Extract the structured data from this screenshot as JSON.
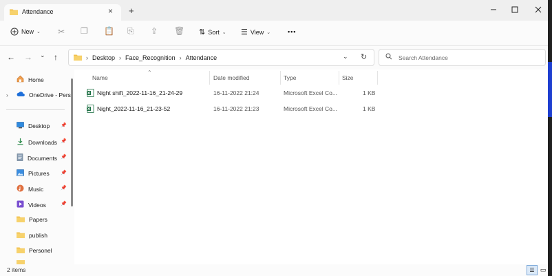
{
  "window": {
    "tab_title": "Attendance",
    "new_tab": "+",
    "minimize": "—",
    "maximize": "☐",
    "close": "✕"
  },
  "toolbar": {
    "new_label": "New",
    "sort_label": "Sort",
    "view_label": "View",
    "more_label": "•••"
  },
  "address": {
    "crumbs": [
      "Desktop",
      "Face_Recognition",
      "Attendance"
    ],
    "search_placeholder": "Search Attendance"
  },
  "sidebar": {
    "home": "Home",
    "onedrive": "OneDrive - Perso",
    "items": [
      {
        "label": "Desktop",
        "icon": "desktop-icon",
        "pinned": true
      },
      {
        "label": "Downloads",
        "icon": "download-icon",
        "pinned": true
      },
      {
        "label": "Documents",
        "icon": "document-icon",
        "pinned": true
      },
      {
        "label": "Pictures",
        "icon": "pictures-icon",
        "pinned": true
      },
      {
        "label": "Music",
        "icon": "music-icon",
        "pinned": true
      },
      {
        "label": "Videos",
        "icon": "videos-icon",
        "pinned": true
      },
      {
        "label": "Papers",
        "icon": "folder-icon",
        "pinned": false
      },
      {
        "label": "publish",
        "icon": "folder-icon",
        "pinned": false
      },
      {
        "label": "Personel",
        "icon": "folder-icon",
        "pinned": false
      }
    ]
  },
  "columns": {
    "name": "Name",
    "date": "Date modified",
    "type": "Type",
    "size": "Size"
  },
  "files": [
    {
      "name": "Night shift_2022-11-16_21-24-29",
      "date": "16-11-2022 21:24",
      "type": "Microsoft Excel Co...",
      "size": "1 KB"
    },
    {
      "name": "Night_2022-11-16_21-23-52",
      "date": "16-11-2022 21:23",
      "type": "Microsoft Excel Co...",
      "size": "1 KB"
    }
  ],
  "status": {
    "count": "2 items"
  },
  "colors": {
    "folder": "#f2c14e",
    "excel": "#1d7044",
    "accent": "#1e3fd0"
  }
}
